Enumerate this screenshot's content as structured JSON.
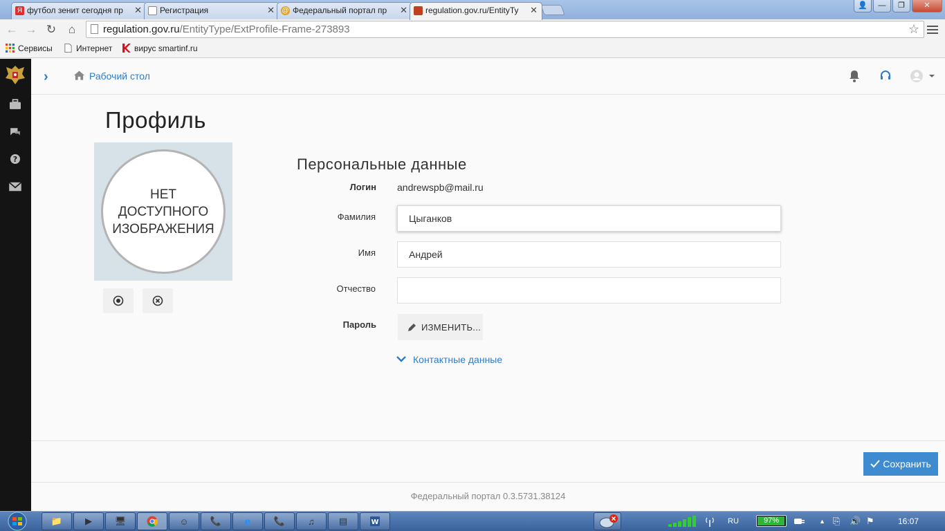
{
  "browser": {
    "tabs": [
      {
        "title": "футбол зенит сегодня пр",
        "favicon": "yandex-icon",
        "color": "#e02c2c"
      },
      {
        "title": "Регистрация",
        "favicon": "page-icon",
        "color": "#ffffff"
      },
      {
        "title": "Федеральный портал пр",
        "favicon": "portal-icon",
        "color": "#e0a020"
      },
      {
        "title": "regulation.gov.ru/EntityTy",
        "favicon": "regulation-icon",
        "color": "#c04020"
      }
    ],
    "url_host": "regulation.gov.ru",
    "url_path": "/EntityType/ExtProfile-Frame-273893",
    "bookmarks": [
      {
        "label": "Сервисы",
        "icon": "apps-grid-icon"
      },
      {
        "label": "Интернет",
        "icon": "page-icon"
      },
      {
        "label": "вирус smartinf.ru",
        "icon": "kaspersky-icon"
      }
    ]
  },
  "app": {
    "breadcrumb_home": "Рабочий стол",
    "page_title": "Профиль",
    "avatar_placeholder": "НЕТ ДОСТУПНОГО ИЗОБРАЖЕНИЯ",
    "section_title": "Персональные данные",
    "fields": {
      "login_label": "Логин",
      "login_value": "andrewspb@mail.ru",
      "surname_label": "Фамилия",
      "surname_value": "Цыганков",
      "name_label": "Имя",
      "name_value": "Андрей",
      "patronymic_label": "Отчество",
      "patronymic_value": "",
      "password_label": "Пароль",
      "password_button": "ИЗМЕНИТЬ..."
    },
    "contacts_link": "Контактные данные",
    "save_button": "Сохранить",
    "version": "Федеральный портал 0.3.5731.38124",
    "accent_color": "#2f7cc6"
  },
  "taskbar": {
    "language": "RU",
    "battery_percent": "97%",
    "battery_level": 0.97,
    "clock": "16:07"
  }
}
